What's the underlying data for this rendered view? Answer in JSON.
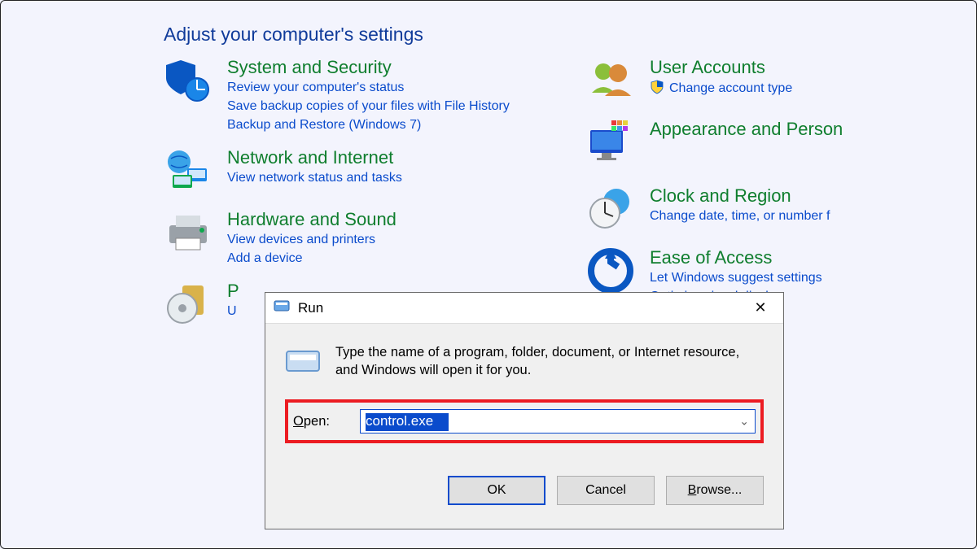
{
  "page_title": "Adjust your computer's settings",
  "left_categories": [
    {
      "title": "System and Security",
      "links": [
        "Review your computer's status",
        "Save backup copies of your files with File History",
        "Backup and Restore (Windows 7)"
      ]
    },
    {
      "title": "Network and Internet",
      "links": [
        "View network status and tasks"
      ]
    },
    {
      "title": "Hardware and Sound",
      "links": [
        "View devices and printers",
        "Add a device"
      ]
    },
    {
      "title": "P",
      "links": [
        "U"
      ]
    }
  ],
  "right_categories": [
    {
      "title": "User Accounts",
      "links": [
        "Change account type"
      ],
      "link_shield": true
    },
    {
      "title": "Appearance and Person",
      "links": []
    },
    {
      "title": "Clock and Region",
      "links": [
        "Change date, time, or number f"
      ]
    },
    {
      "title": "Ease of Access",
      "links": [
        "Let Windows suggest settings",
        "Optimize visual display"
      ]
    }
  ],
  "run": {
    "title": "Run",
    "description": "Type the name of a program, folder, document, or Internet resource, and Windows will open it for you.",
    "open_label": "Open:",
    "open_value": "control.exe",
    "buttons": {
      "ok": "OK",
      "cancel": "Cancel",
      "browse": "Browse..."
    }
  }
}
